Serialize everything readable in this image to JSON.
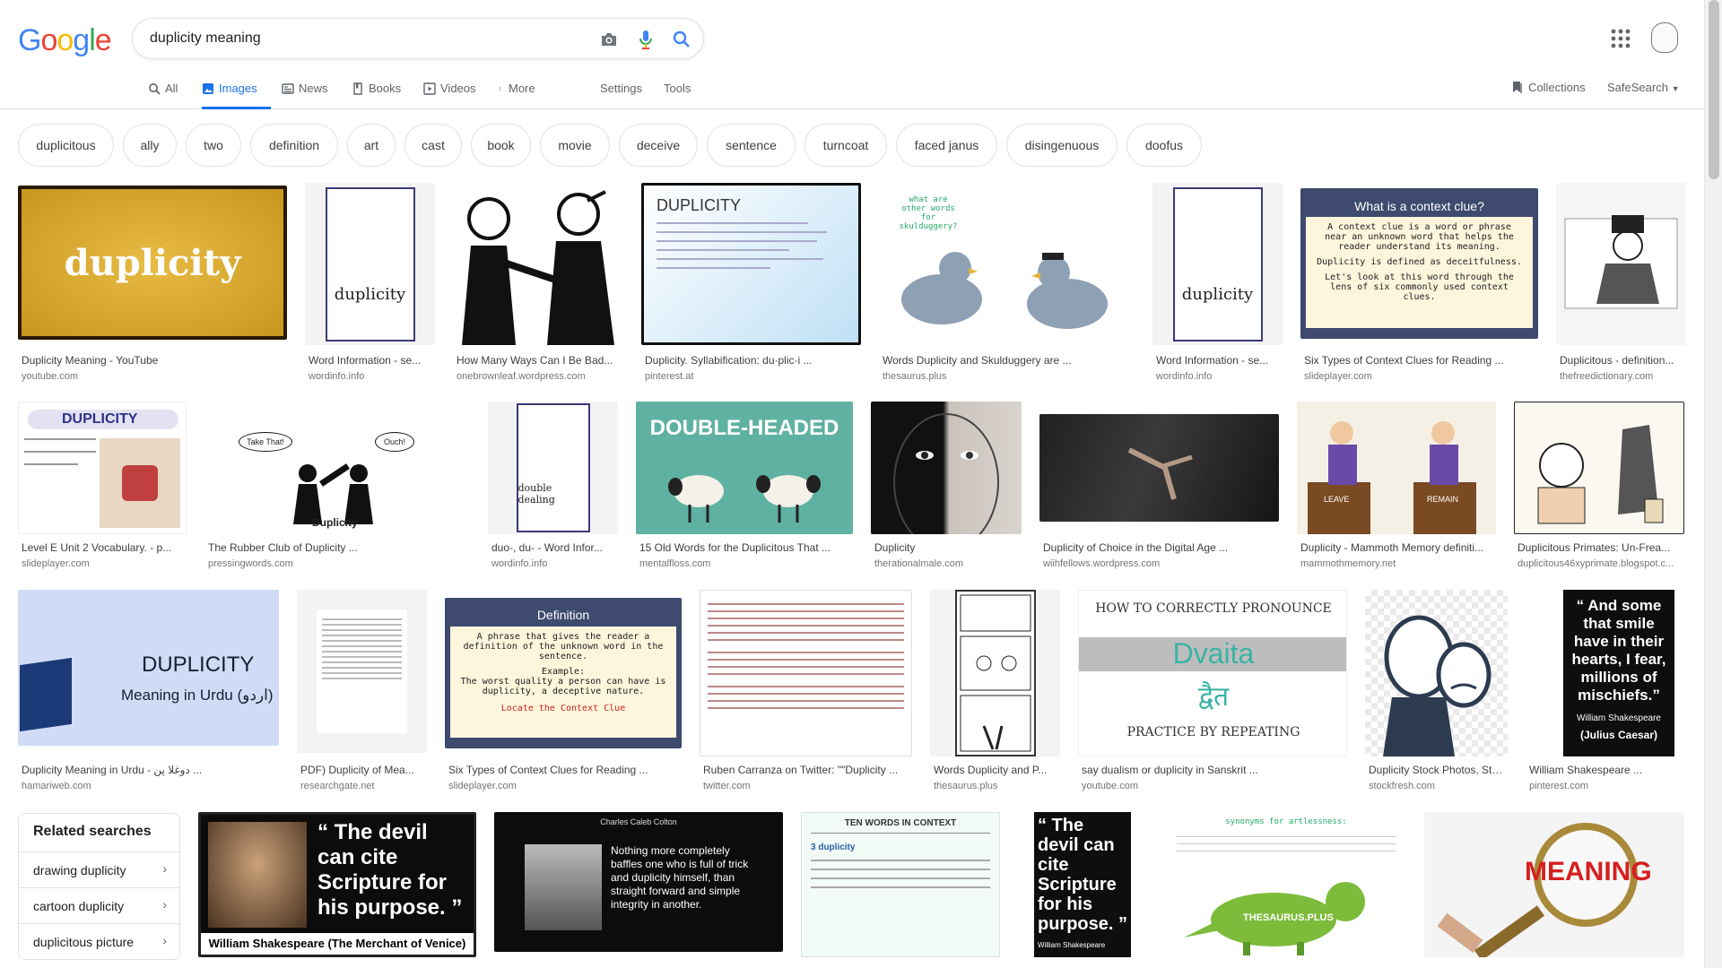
{
  "brand": {
    "logo_letters": [
      "G",
      "o",
      "o",
      "g",
      "l",
      "e"
    ],
    "logo_colors": [
      "#4285F4",
      "#EA4335",
      "#FBBC05",
      "#4285F4",
      "#34A853",
      "#EA4335"
    ]
  },
  "search": {
    "query": "duplicity meaning"
  },
  "tabs": [
    {
      "label": "All",
      "icon": "search-icon"
    },
    {
      "label": "Images",
      "icon": "image-icon",
      "active": true
    },
    {
      "label": "News",
      "icon": "news-icon"
    },
    {
      "label": "Books",
      "icon": "book-icon"
    },
    {
      "label": "Videos",
      "icon": "video-icon"
    },
    {
      "label": "More",
      "icon": "more-dots-icon"
    },
    {
      "label": "Settings"
    },
    {
      "label": "Tools"
    }
  ],
  "right_tools": {
    "collections": "Collections",
    "safesearch": "SafeSearch"
  },
  "chips": [
    "duplicitous",
    "ally",
    "two",
    "definition",
    "art",
    "cast",
    "book",
    "movie",
    "deceive",
    "sentence",
    "turncoat",
    "faced janus",
    "disingenuous",
    "doofus"
  ],
  "results": [
    {
      "title": "Duplicity Meaning - YouTube",
      "domain": "youtube.com",
      "img_text": "duplicity"
    },
    {
      "title": "Word Information - se...",
      "domain": "wordinfo.info",
      "img_text": "duplicity"
    },
    {
      "title": "How Many Ways Can I Be Bad...",
      "domain": "onebrownleaf.wordpress.com",
      "img_text": ""
    },
    {
      "title": "Duplicity. Syllabification: du·plic·i ...",
      "domain": "pinterest.at",
      "img_text": "DUPLICITY"
    },
    {
      "title": "Words Duplicity and Skulduggery are ...",
      "domain": "thesaurus.plus",
      "img_text": "what are other words for skulduggery?"
    },
    {
      "title": "Word Information - se...",
      "domain": "wordinfo.info",
      "img_text": "duplicity"
    },
    {
      "title": "Six Types of Context Clues for Reading ...",
      "domain": "slideplayer.com",
      "img_text": "What is a context clue?"
    },
    {
      "title": "Duplicitous - definition...",
      "domain": "thefreedictionary.com",
      "img_text": ""
    },
    {
      "title": "Level E Unit 2 Vocabulary. - p...",
      "domain": "slideplayer.com",
      "img_text": "DUPLICITY"
    },
    {
      "title": "The Rubber Club of Duplicity ...",
      "domain": "pressingwords.com",
      "img_text": "Duplicity"
    },
    {
      "title": "duo-, du- - Word Infor...",
      "domain": "wordinfo.info",
      "img_text": "double dealing"
    },
    {
      "title": "15 Old Words for the Duplicitous That ...",
      "domain": "mentalfloss.com",
      "img_text": "DOUBLE-HEADED"
    },
    {
      "title": "Duplicity",
      "domain": "therationalmale.com",
      "img_text": ""
    },
    {
      "title": "Duplicity of Choice in the Digital Age ...",
      "domain": "wiihfellows.wordpress.com",
      "img_text": ""
    },
    {
      "title": "Duplicity - Mammoth Memory definiti...",
      "domain": "mammothmemory.net",
      "img_text": "LEAVE"
    },
    {
      "title": "Duplicitous Primates: Un-Frea...",
      "domain": "duplicitous46xyprimate.blogspot.c...",
      "img_text": ""
    },
    {
      "title": "Duplicity Meaning in Urdu - دوغلا پن ...",
      "domain": "hamariweb.com",
      "img_text": "DUPLICITY"
    },
    {
      "title": "PDF) Duplicity of Mea...",
      "domain": "researchgate.net",
      "img_text": ""
    },
    {
      "title": "Six Types of Context Clues for Reading ...",
      "domain": "slideplayer.com",
      "img_text": "Definition"
    },
    {
      "title": "Ruben Carranza on Twitter: \"\"Duplicity ...",
      "domain": "twitter.com",
      "img_text": ""
    },
    {
      "title": "Words Duplicity and P...",
      "domain": "thesaurus.plus",
      "img_text": ""
    },
    {
      "title": "say dualism or duplicity in Sanskrit ...",
      "domain": "youtube.com",
      "img_text": "HOW TO CORRECTLY PRONOUNCE"
    },
    {
      "title": "Duplicity Stock Photos, Stock I...",
      "domain": "stockfresh.com",
      "img_text": ""
    },
    {
      "title": "William Shakespeare ...",
      "domain": "pinterest.com",
      "img_text": "“ And some that smile have in their hearts, I fear, millions of mischiefs.”"
    }
  ],
  "img_extra": {
    "urdu_line": "Meaning in Urdu (اردو)",
    "context_line1": "A context clue is a word or phrase near an unknown word that helps the reader understand its meaning.",
    "context_line2": "Duplicity is defined as deceitfulness.",
    "context_line3": "Let's look at this word through the lens of six commonly used context clues.",
    "def_line1": "A phrase that gives the reader a definition of the unknown word in the sentence.",
    "def_line2": "Example:",
    "def_line3": "The worst quality a person can have is duplicity, a deceptive nature.",
    "def_line4": "Locate the Context Clue",
    "dvaita": "Dvaita",
    "dvaita_dev": "द्वैत",
    "practice": "PRACTICE BY REPEATING",
    "shakes_attrib1": "William Shakespeare",
    "shakes_attrib2": "(Julius Caesar)",
    "remain_label": "REMAIN",
    "ouch1": "Take That!",
    "ouch2": "Ouch!"
  },
  "bottom_row": [
    {
      "img_text": "“ The devil can cite Scripture for his purpose. ”",
      "caption": "William Shakespeare  (The Merchant of Venice)"
    },
    {
      "img_text": "Nothing more completely baffles one who is full of trick and duplicity himself, than straight forward and simple integrity in another.",
      "caption": "Charles Caleb Colton"
    },
    {
      "img_text": "TEN WORDS IN CONTEXT",
      "caption": "3 duplicity"
    },
    {
      "img_text": "“ The devil can cite Scripture for his purpose. ”",
      "caption": "William Shakespeare"
    },
    {
      "img_text": "synonyms for artlessness:",
      "caption": "THESAURUS.PLUS"
    },
    {
      "img_text": "MEANING",
      "caption": ""
    }
  ],
  "related": {
    "title": "Related searches",
    "items": [
      "drawing duplicity",
      "cartoon duplicity",
      "duplicitous picture"
    ]
  }
}
